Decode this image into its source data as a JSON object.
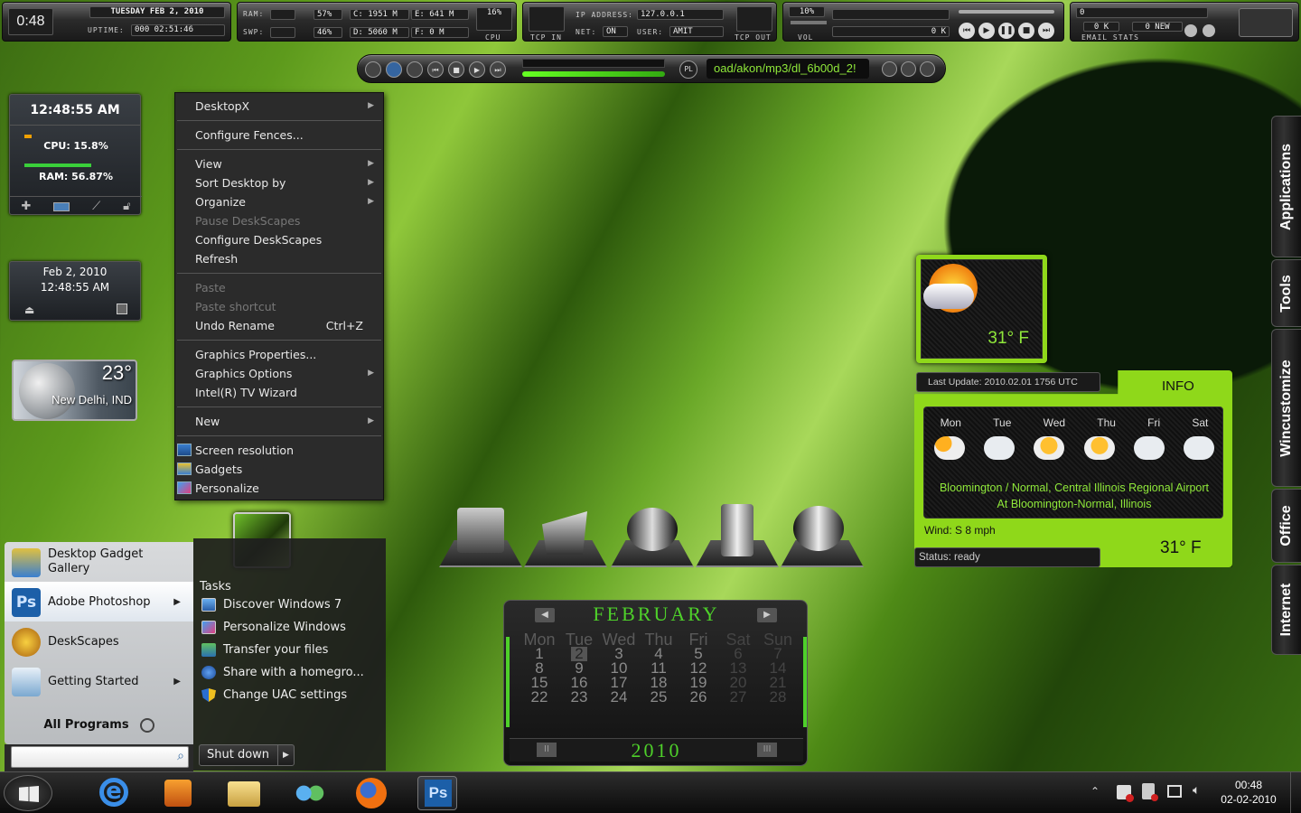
{
  "topbar": {
    "time": "0:48",
    "date": "TUESDAY FEB 2, 2010",
    "uptime_label": "UPTIME:",
    "uptime": "000 02:51:46",
    "ram_label": "RAM:",
    "ram_pct": "57%",
    "swp_label": "SWP:",
    "swp_pct": "46%",
    "c_label": "C:",
    "c_val": "1951 M",
    "e_label": "E:",
    "e_val": "641 M",
    "d_label": "D:",
    "d_val": "5060 M",
    "f_label": "F:",
    "f_val": "0 M",
    "cpu_pct": "16%",
    "cpu_label": "CPU",
    "tcp_in": "TCP IN",
    "ip_label": "IP ADDRESS:",
    "ip": "127.0.0.1",
    "net_label": "NET:",
    "net": "ON",
    "user_label": "USER:",
    "user": "AMIT",
    "tcp_out": "TCP OUT",
    "vol_pct": "10%",
    "vol_label": "VOL",
    "k_left": "0 K",
    "mail_count": "0",
    "mail_k": "0 K",
    "mail_new": "0 NEW",
    "email_stats": "EMAIL STATS"
  },
  "player": {
    "pl_label": "PL",
    "track": "oad/akon/mp3/dl_6b00d_2!"
  },
  "sysmon": {
    "time": "12:48:55 AM",
    "cpu": "CPU: 15.8%",
    "ram": "RAM: 56.87%"
  },
  "clock": {
    "date": "Feb 2, 2010",
    "time": "12:48:55 AM"
  },
  "weather_small": {
    "temp": "23°",
    "city": "New Delhi, IND"
  },
  "context_menu": {
    "desktopx": "DesktopX",
    "fences": "Configure Fences...",
    "view": "View",
    "sort": "Sort Desktop by",
    "organize": "Organize",
    "pause": "Pause DeskScapes",
    "configure_ds": "Configure DeskScapes",
    "refresh": "Refresh",
    "paste": "Paste",
    "paste_shortcut": "Paste shortcut",
    "undo": "Undo Rename",
    "undo_sc": "Ctrl+Z",
    "gfx_props": "Graphics Properties...",
    "gfx_opts": "Graphics Options",
    "intel_tv": "Intel(R) TV Wizard",
    "new": "New",
    "screen_res": "Screen resolution",
    "gadgets": "Gadgets",
    "personalize": "Personalize"
  },
  "start_menu": {
    "left_items": [
      {
        "label": "Desktop Gadget Gallery"
      },
      {
        "label": "Adobe Photoshop"
      },
      {
        "label": "DeskScapes"
      },
      {
        "label": "Getting Started"
      }
    ],
    "all_programs": "All Programs",
    "tasks_heading": "Tasks",
    "tasks": [
      "Discover Windows 7",
      "Personalize Windows",
      "Transfer your files",
      "Share with a homegro...",
      "Change UAC settings"
    ],
    "shutdown": "Shut down"
  },
  "weather_big": {
    "temp": "31° F",
    "last_update": "Last Update: 2010.02.01 1756 UTC",
    "info": "INFO",
    "days": [
      "Mon",
      "Tue",
      "Wed",
      "Thu",
      "Fri",
      "Sat"
    ],
    "location": "Bloomington / Normal, Central Illinois Regional Airport At Bloomington-Normal, Illinois",
    "wind": "Wind: S 8 mph",
    "status": "Status: ready",
    "temp2": "31° F"
  },
  "calendar": {
    "month": "FEBRUARY",
    "year": "2010",
    "nav_left": "II",
    "nav_right": "III",
    "day_names": [
      "Mon",
      "Tue",
      "Wed",
      "Thu",
      "Fri",
      "Sat",
      "Sun"
    ],
    "weeks_by_day": [
      [
        "1",
        "8",
        "15",
        "22"
      ],
      [
        "2",
        "9",
        "16",
        "23"
      ],
      [
        "3",
        "10",
        "17",
        "24"
      ],
      [
        "4",
        "11",
        "18",
        "25"
      ],
      [
        "5",
        "12",
        "19",
        "26"
      ],
      [
        "6",
        "13",
        "20",
        "27"
      ],
      [
        "7",
        "14",
        "21",
        "28"
      ]
    ]
  },
  "right_tabs": [
    "Applications",
    "Tools",
    "Wincustomize",
    "Office",
    "Internet"
  ],
  "tray": {
    "time": "00:48",
    "date": "02-02-2010"
  },
  "colors": {
    "accent": "#8fd81a",
    "menu_bg": "#2b2b2b",
    "start_left": "#c9cbce"
  }
}
